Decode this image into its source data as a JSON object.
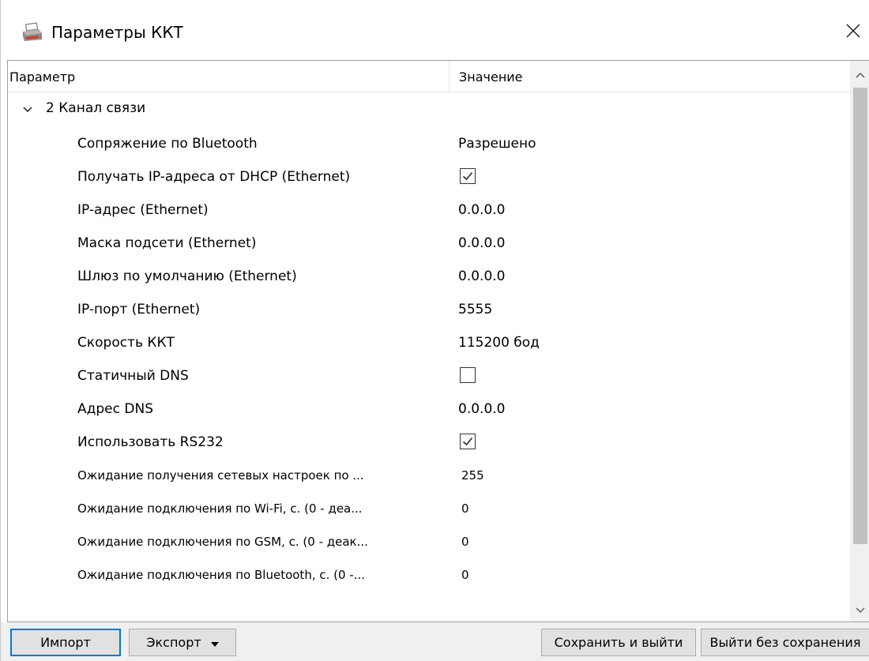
{
  "window": {
    "title": "Параметры ККТ",
    "icon": "printer-icon",
    "close_icon": "close-icon"
  },
  "grid": {
    "columns": {
      "param": "Параметр",
      "value": "Значение"
    },
    "group": {
      "label": "2 Канал связи",
      "expanded": true
    },
    "rows": [
      {
        "name": "Сопряжение по Bluetooth",
        "type": "text",
        "value": "Разрешено"
      },
      {
        "name": "Получать IP-адреса от DHCP (Ethernet)",
        "type": "checkbox",
        "checked": true
      },
      {
        "name": "IP-адрес (Ethernet)",
        "type": "text",
        "value": "0.0.0.0"
      },
      {
        "name": "Маска подсети (Ethernet)",
        "type": "text",
        "value": "0.0.0.0"
      },
      {
        "name": "Шлюз по умолчанию (Ethernet)",
        "type": "text",
        "value": "0.0.0.0"
      },
      {
        "name": "IP-порт (Ethernet)",
        "type": "text",
        "value": "5555"
      },
      {
        "name": "Скорость ККТ",
        "type": "text",
        "value": "115200 бод"
      },
      {
        "name": "Статичный DNS",
        "type": "checkbox",
        "checked": false
      },
      {
        "name": "Адрес DNS",
        "type": "text",
        "value": "0.0.0.0"
      },
      {
        "name": "Использовать RS232",
        "type": "checkbox",
        "checked": true
      },
      {
        "name": "Ожидание получения сетевых настроек по ...",
        "type": "text",
        "value": "255",
        "small": true
      },
      {
        "name": "Ожидание подключения по Wi-Fi, с. (0 - деа...",
        "type": "text",
        "value": "0",
        "small": true
      },
      {
        "name": "Ожидание подключения по GSM, с. (0 - деак...",
        "type": "text",
        "value": "0",
        "small": true
      },
      {
        "name": "Ожидание подключения по Bluetooth, с. (0 -...",
        "type": "text",
        "value": "0",
        "small": true
      }
    ]
  },
  "buttons": {
    "import": "Импорт",
    "export": "Экспорт",
    "save_exit": "Сохранить и выйти",
    "exit_no_save": "Выйти без сохранения"
  },
  "colors": {
    "focus_border": "#0078d7",
    "button_bg": "#e1e1e1",
    "scroll_thumb": "#c0c0c0"
  }
}
